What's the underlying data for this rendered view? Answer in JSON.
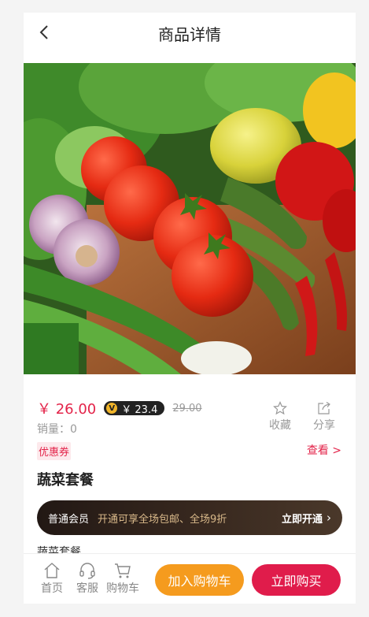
{
  "header": {
    "title": "商品详情"
  },
  "product": {
    "price": "￥ 26.00",
    "vip_icon": "V",
    "vip_price": "￥ 23.4",
    "original_price": "29.00",
    "sales": "销量：0",
    "coupon_label": "优惠券",
    "coupon_link": "查看 >",
    "name": "蔬菜套餐",
    "subtitle": "蔬菜套餐"
  },
  "actions": {
    "favorite": "收藏",
    "share": "分享"
  },
  "member": {
    "level": "普通会员",
    "benefit": "开通可享全场包邮、全场9折",
    "cta": "立即开通"
  },
  "tabbar": {
    "home": "首页",
    "service": "客服",
    "cart": "购物车",
    "add_to_cart": "加入购物车",
    "buy_now": "立即购买"
  },
  "colors": {
    "accent": "#e32349",
    "cart": "#f59b1e",
    "buy": "#e01c4b"
  }
}
